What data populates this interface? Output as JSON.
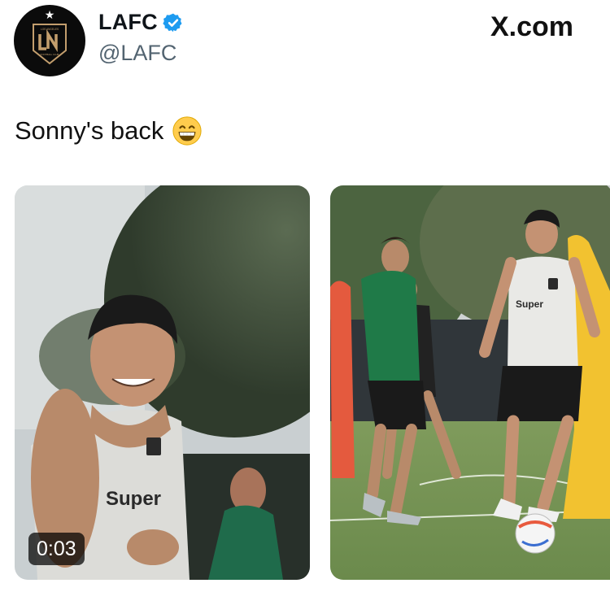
{
  "account": {
    "display_name": "LAFC",
    "handle": "@LAFC",
    "verified": true,
    "avatar": "lafc-crest-logo",
    "crest_text": "LOS ANGELES FOOTBALL CLUB"
  },
  "site_label": "X.com",
  "tweet": {
    "text": "Sonny's back",
    "emoji": "grinning-face-with-smiling-eyes"
  },
  "media": [
    {
      "kind": "video",
      "duration": "0:03",
      "jersey_text": "Super"
    },
    {
      "kind": "photo",
      "jersey_text": "Super"
    }
  ],
  "colors": {
    "verified_blue": "#1d9bf0",
    "handle_gray": "#536471",
    "lafc_gold": "#c39e6d",
    "lafc_black": "#0b0b0b"
  }
}
